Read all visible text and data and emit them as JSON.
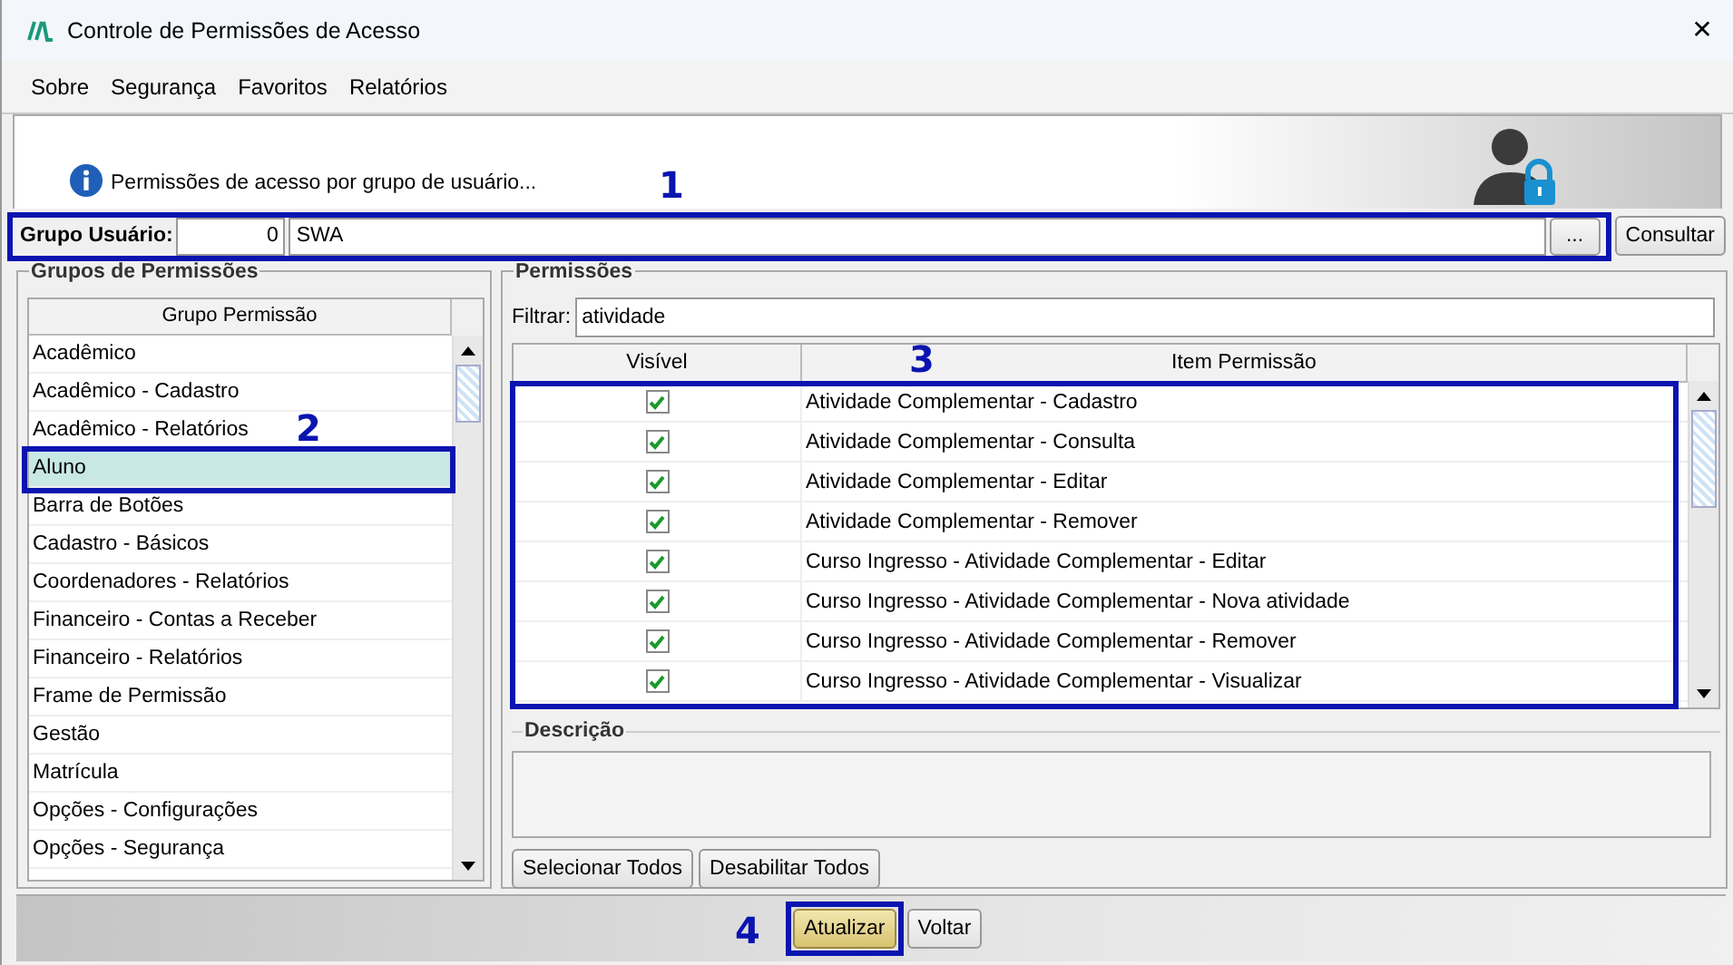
{
  "window": {
    "title": "Controle de Permissões de Acesso",
    "close": "✕"
  },
  "menu": [
    "Sobre",
    "Segurança",
    "Favoritos",
    "Relatórios"
  ],
  "header": {
    "info": "Permissões de acesso por grupo de usuário..."
  },
  "grupo_usuario": {
    "label": "Grupo Usuário:",
    "code": "0",
    "name": "SWA",
    "browse": "...",
    "button": "Consultar"
  },
  "grupos": {
    "title": "Grupos de Permissões",
    "column": "Grupo Permissão",
    "items": [
      {
        "label": "Acadêmico",
        "selected": false
      },
      {
        "label": "Acadêmico - Cadastro",
        "selected": false
      },
      {
        "label": "Acadêmico - Relatórios",
        "selected": false
      },
      {
        "label": "Aluno",
        "selected": true
      },
      {
        "label": "Barra de Botões",
        "selected": false
      },
      {
        "label": "Cadastro - Básicos",
        "selected": false
      },
      {
        "label": "Coordenadores - Relatórios",
        "selected": false
      },
      {
        "label": "Financeiro - Contas a Receber",
        "selected": false
      },
      {
        "label": "Financeiro - Relatórios",
        "selected": false
      },
      {
        "label": "Frame de Permissão",
        "selected": false
      },
      {
        "label": "Gestão",
        "selected": false
      },
      {
        "label": "Matrícula",
        "selected": false
      },
      {
        "label": "Opções - Configurações",
        "selected": false
      },
      {
        "label": "Opções - Segurança",
        "selected": false
      }
    ]
  },
  "permissoes": {
    "title": "Permissões",
    "filter_label": "Filtrar:",
    "filter_value": "atividade",
    "columns": [
      "Visível",
      "Item Permissão"
    ],
    "rows": [
      {
        "visible": true,
        "item": "Atividade Complementar - Cadastro"
      },
      {
        "visible": true,
        "item": "Atividade Complementar - Consulta"
      },
      {
        "visible": true,
        "item": "Atividade Complementar - Editar"
      },
      {
        "visible": true,
        "item": "Atividade Complementar - Remover"
      },
      {
        "visible": true,
        "item": "Curso Ingresso - Atividade Complementar - Editar"
      },
      {
        "visible": true,
        "item": "Curso Ingresso - Atividade Complementar - Nova atividade"
      },
      {
        "visible": true,
        "item": "Curso Ingresso - Atividade Complementar - Remover"
      },
      {
        "visible": true,
        "item": "Curso Ingresso - Atividade Complementar - Visualizar"
      }
    ],
    "description_title": "Descrição",
    "buttons": [
      "Selecionar Todos",
      "Desabilitar Todos"
    ]
  },
  "footer_buttons": [
    {
      "label": "Atualizar",
      "kind": "primary"
    },
    {
      "label": "Voltar",
      "kind": "normal"
    }
  ],
  "callouts": [
    "1",
    "2",
    "3",
    "4"
  ]
}
